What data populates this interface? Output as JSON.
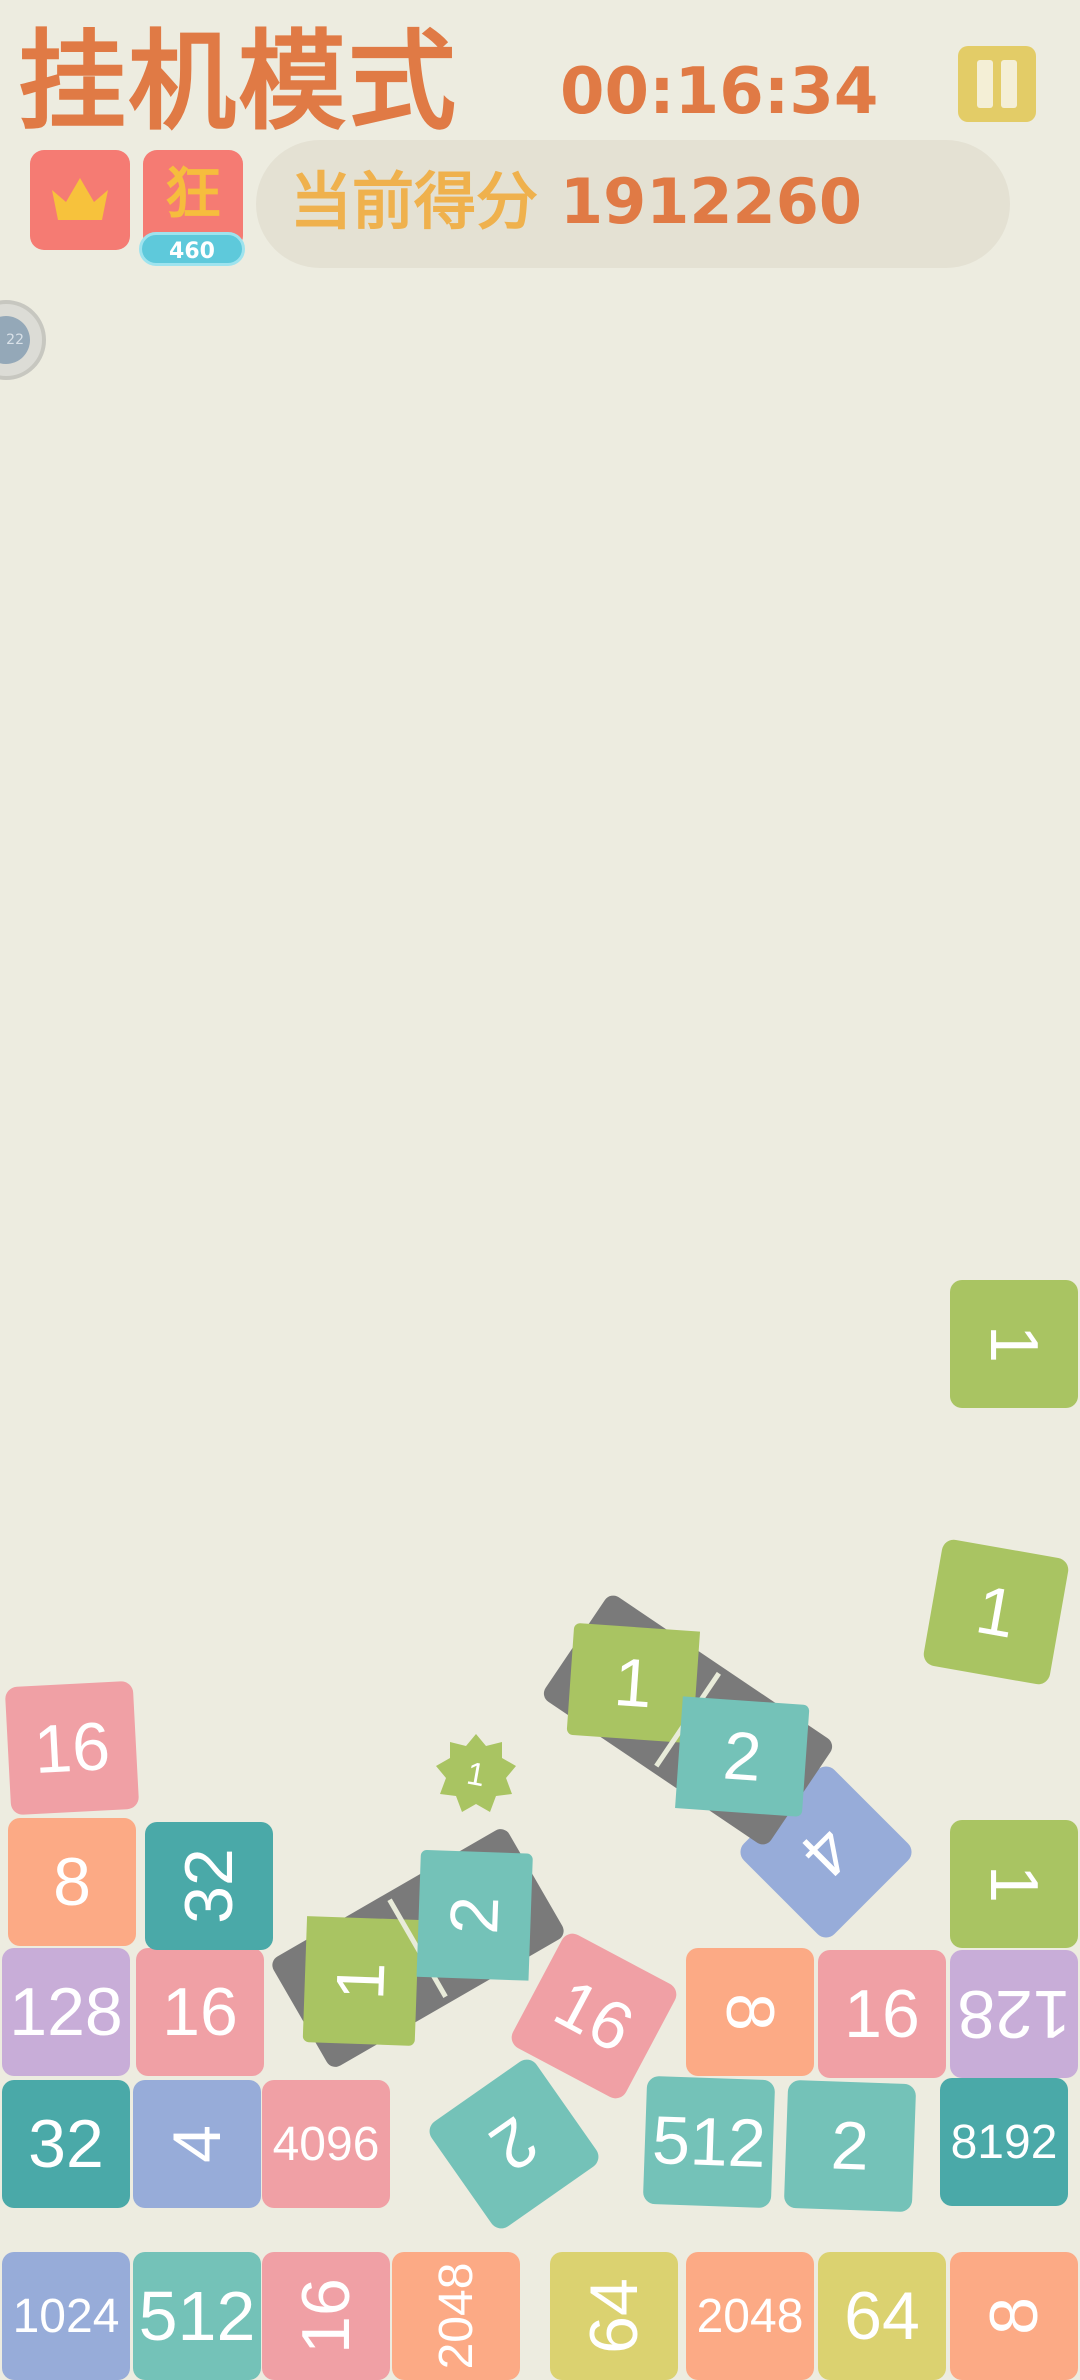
{
  "header": {
    "title": "挂机模式",
    "timer": "00:16:34",
    "score_label": "当前得分",
    "score_value": "1912260"
  },
  "buttons": {
    "crown_icon": "crown-icon",
    "pause_icon": "pause-icon",
    "mad_label": "狂",
    "mad_count": "460"
  },
  "side_indicator": {
    "text": "22"
  },
  "colors": {
    "background": "#edece0",
    "accent_orange": "#e07a45",
    "accent_yellow": "#efb14d",
    "tile_1": "#a9c462",
    "tile_2": "#74c2b8",
    "tile_4": "#97acd9",
    "tile_8": "#fcaa85",
    "tile_16": "#f0a0a5",
    "tile_32": "#4aa9a8",
    "tile_64": "#dbd270",
    "tile_128": "#c8add8",
    "tile_512": "#74c2b8",
    "tile_1024": "#97acd9",
    "tile_2048": "#fcaa85",
    "tile_4096": "#f0a0a5",
    "tile_8192": "#4aa9a8"
  },
  "board": {
    "tiles": [
      {
        "id": "r1-1",
        "label": "1024",
        "value": 1024
      },
      {
        "id": "r1-2",
        "label": "512",
        "value": 512
      },
      {
        "id": "r1-3",
        "label": "16",
        "value": 16
      },
      {
        "id": "r1-4",
        "label": "2048",
        "value": 2048
      },
      {
        "id": "r1-5",
        "label": "64",
        "value": 64
      },
      {
        "id": "r1-6",
        "label": "2048",
        "value": 2048
      },
      {
        "id": "r1-7",
        "label": "64",
        "value": 64
      },
      {
        "id": "r1-8",
        "label": "8",
        "value": 8
      },
      {
        "id": "r2-1",
        "label": "32",
        "value": 32
      },
      {
        "id": "r2-2",
        "label": "4",
        "value": 4
      },
      {
        "id": "r2-3",
        "label": "4096",
        "value": 4096
      },
      {
        "id": "r2-4",
        "label": "2",
        "value": 2
      },
      {
        "id": "r2-5",
        "label": "512",
        "value": 512
      },
      {
        "id": "r2-6",
        "label": "2",
        "value": 2
      },
      {
        "id": "r2-7",
        "label": "8192",
        "value": 8192
      },
      {
        "id": "r3-1",
        "label": "128",
        "value": 128
      },
      {
        "id": "r3-2",
        "label": "16",
        "value": 16
      },
      {
        "id": "r3-3",
        "label": "16",
        "value": 16
      },
      {
        "id": "r3-4",
        "label": "8",
        "value": 8
      },
      {
        "id": "r3-5",
        "label": "16",
        "value": 16
      },
      {
        "id": "r3-6",
        "label": "128",
        "value": 128
      },
      {
        "id": "r4-1",
        "label": "8",
        "value": 8
      },
      {
        "id": "r4-2",
        "label": "32",
        "value": 32
      },
      {
        "id": "r4-3",
        "label": "4",
        "value": 4
      },
      {
        "id": "r4-4",
        "label": "1",
        "value": 1
      },
      {
        "id": "r5-1",
        "label": "16",
        "value": 16
      },
      {
        "id": "f-1",
        "label": "1",
        "value": 1
      },
      {
        "id": "f-2",
        "label": "1",
        "value": 1
      }
    ],
    "dominoes": [
      {
        "id": "d1",
        "left": "1",
        "right": "2"
      },
      {
        "id": "d2",
        "left": "1",
        "right": "2"
      }
    ],
    "star_bonus": {
      "label": "1"
    }
  }
}
